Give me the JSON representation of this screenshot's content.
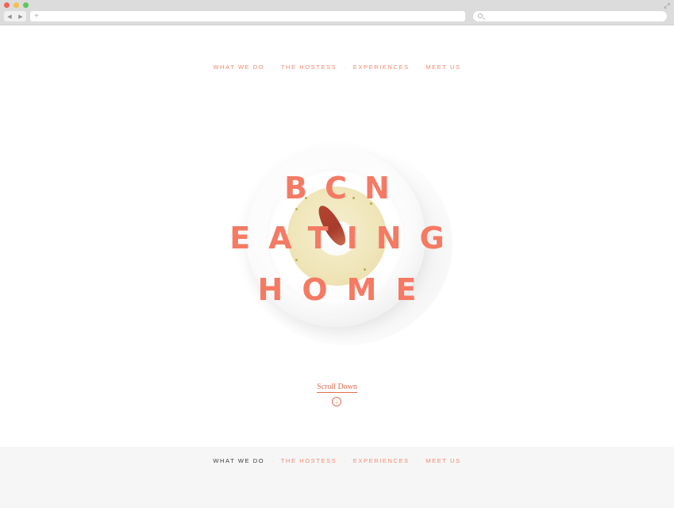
{
  "browser": {
    "back_glyph": "◀",
    "forward_glyph": "▶",
    "new_tab_glyph": "+",
    "fullscreen_glyph": "⤢",
    "address_url": "",
    "search_value": ""
  },
  "nav": {
    "items": [
      "WHAT WE DO",
      "THE HOSTESS",
      "EXPERIENCES",
      "MEET US"
    ],
    "separator": "·"
  },
  "hero": {
    "line1": "BCN",
    "line2": "EATING",
    "line3": "HOME"
  },
  "scroll": {
    "label": "Scroll Down",
    "icon_glyph": "↓"
  },
  "colors": {
    "accent": "#f57a64",
    "nav_text": "#f28a70",
    "nav_active": "#3c3c3c",
    "bottom_bg": "#f6f6f6"
  }
}
